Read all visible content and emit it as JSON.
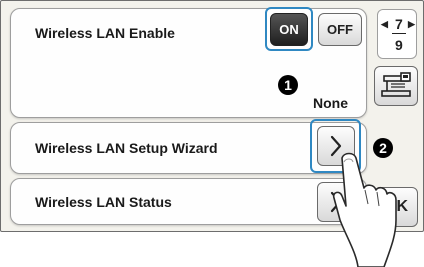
{
  "rows": [
    {
      "label": "Wireless LAN Enable"
    },
    {
      "label": "Wireless LAN Setup Wizard"
    },
    {
      "label": "Wireless LAN Status"
    }
  ],
  "toggle": {
    "on_label": "ON",
    "off_label": "OFF"
  },
  "status_value": "None",
  "callouts": [
    "1",
    "2"
  ],
  "pagination": {
    "current": "7",
    "total": "9"
  },
  "ok_label": "OK",
  "colors": {
    "highlight": "#2f88c2",
    "on_button": "#2a2a2a",
    "background": "#f3f2ec"
  },
  "icons": [
    "chevron-right-icon",
    "sewing-machine-icon",
    "pointing-hand-icon",
    "page-left-arrow-icon",
    "page-right-arrow-icon"
  ]
}
